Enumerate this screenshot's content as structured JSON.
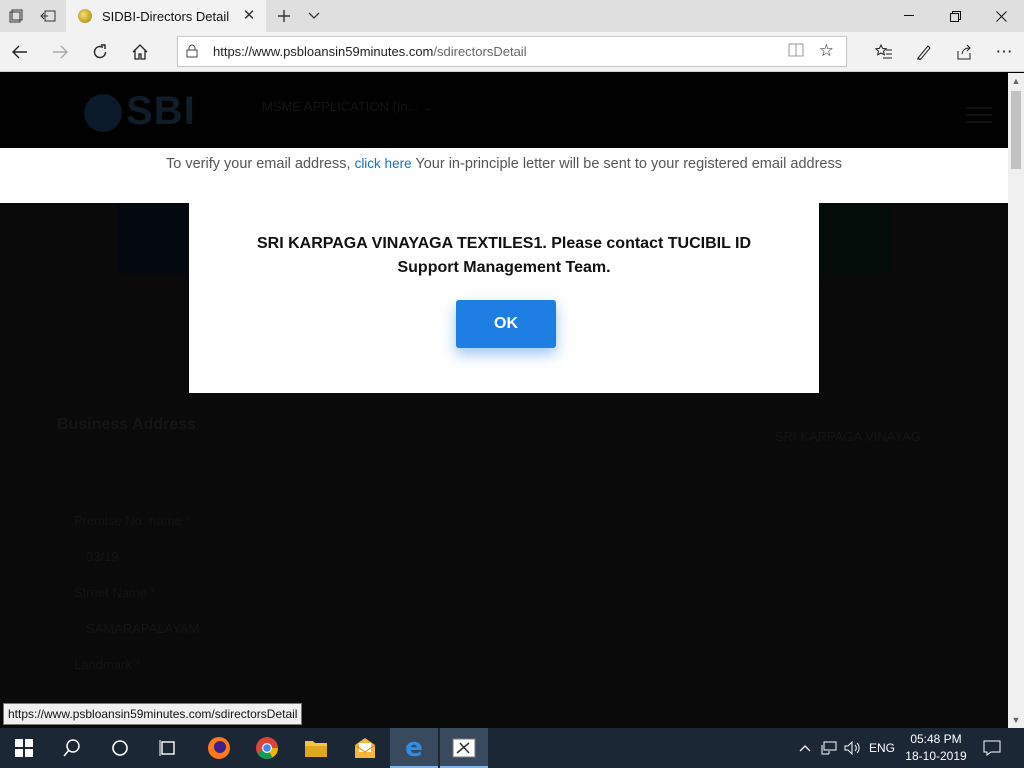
{
  "browser": {
    "tab_title": "SIDBI-Directors Detail",
    "url_host": "https://www.psbloansin59minutes.com",
    "url_path": "/sdirectorsDetail"
  },
  "header": {
    "logo_text": "SBI",
    "app_menu_label": "MSME APPLICATION (In..."
  },
  "verify_banner": {
    "prefix": "To verify your email address,",
    "link": "click here",
    "suffix": "Your in-principle letter will be sent to your registered email address"
  },
  "background_form": {
    "section_title": "Business Address",
    "business_name": "SRI KARPAGA VINAYAG",
    "fields": [
      {
        "label": "Premise No. name *",
        "value": "03/19"
      },
      {
        "label": "Street Name *",
        "value": "SAMARAPALAYAM"
      },
      {
        "label": "Landmark *",
        "value": ""
      }
    ]
  },
  "modal": {
    "message": "SRI KARPAGA VINAYAGA TEXTILES1. Please contact TUCIBIL ID Support Management Team.",
    "ok_label": "OK"
  },
  "status_tooltip": "https://www.psbloansin59minutes.com/sdirectorsDetail",
  "taskbar": {
    "language": "ENG",
    "time": "05:48 PM",
    "date": "18-10-2019"
  },
  "colors": {
    "ok_button": "#1e7ee4",
    "link": "#1a6fc1",
    "taskbar": "#1b2735",
    "overlay": "#0a0a0a"
  }
}
